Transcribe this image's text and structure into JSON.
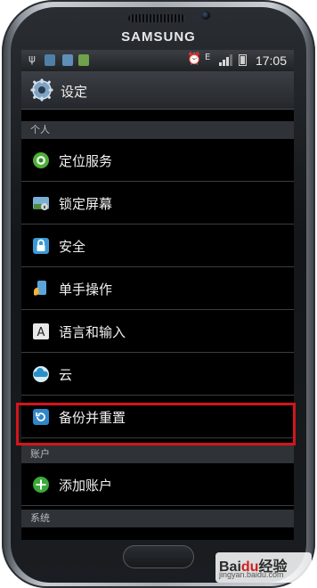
{
  "device": {
    "brand": "SAMSUNG"
  },
  "statusbar": {
    "time": "17:05",
    "network": "E"
  },
  "actionbar": {
    "title": "设定"
  },
  "sections": {
    "personal": "个人",
    "accounts": "账户",
    "system": "系统"
  },
  "menu": {
    "location": "定位服务",
    "lockscreen": "锁定屏幕",
    "security": "安全",
    "onehand": "单手操作",
    "language": "语言和输入",
    "cloud": "云",
    "backup": "备份并重置",
    "add_account": "添加账户"
  },
  "watermark": {
    "logo_a": "Bai",
    "logo_b": "du",
    "logo_c": "经验",
    "url": "jingyan.baidu.com"
  },
  "colors": {
    "highlight": "#d5141b",
    "screen_bg": "#000000",
    "section_bg": "#2f3236"
  }
}
